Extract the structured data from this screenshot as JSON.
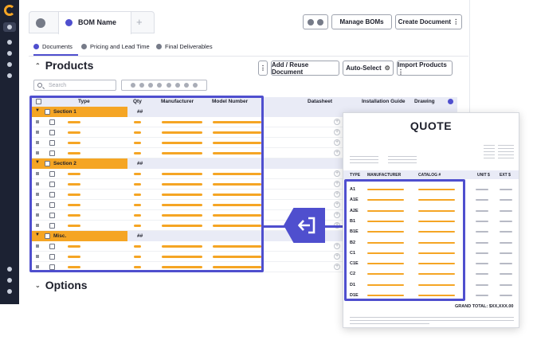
{
  "tabs": {
    "bom_name": "BOM Name",
    "add": "+"
  },
  "toolbar": {
    "manage": "Manage BOMs",
    "create": "Create Document ⋮"
  },
  "subtabs": [
    "Documents",
    "Pricing and Lead Time",
    "Final Deliverables"
  ],
  "products": {
    "title": "Products",
    "more": "⋮",
    "add_reuse": "Add / Reuse Document",
    "auto_select": "Auto-Select",
    "import": "Import Products ⋮",
    "search_placeholder": "Search"
  },
  "table": {
    "columns": [
      "Type",
      "Qty",
      "Manufacturer",
      "Model Number",
      "Datasheet",
      "Installation Guide",
      "Drawing"
    ],
    "sections": [
      {
        "label": "Section 1",
        "qty": "##",
        "rows": 4
      },
      {
        "label": "Section 2",
        "qty": "##",
        "rows": 6
      },
      {
        "label": "Misc.",
        "qty": "##",
        "rows": 3
      }
    ]
  },
  "options": {
    "title": "Options"
  },
  "quote": {
    "title": "QUOTE",
    "columns": [
      "TYPE",
      "MANUFACTURER",
      "CATALOG #",
      "UNIT $",
      "EXT $"
    ],
    "rows": [
      "A1",
      "A1E",
      "A2E",
      "B1",
      "B1E",
      "B2",
      "C1",
      "C1E",
      "C2",
      "D1",
      "D1E"
    ],
    "grand_total": "GRAND TOTAL: $XX,XXX.00"
  },
  "colors": {
    "accent": "#4f4fce",
    "orange": "#f5a524",
    "sidebar": "#1c2233"
  }
}
